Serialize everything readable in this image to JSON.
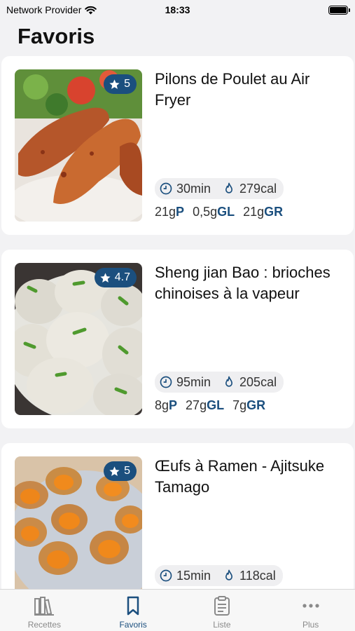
{
  "status": {
    "carrier": "Network Provider",
    "time": "18:33"
  },
  "page": {
    "title": "Favoris"
  },
  "recipes": [
    {
      "title": "Pilons de Poulet au Air Fryer",
      "rating": "5",
      "time": "30min",
      "calories": "279cal",
      "protein": "21g",
      "protein_unit": "P",
      "lipids": "0,5g",
      "lipids_unit": "GL",
      "carbs": "21g",
      "carbs_unit": "GR"
    },
    {
      "title": "Sheng jian Bao : brioches chinoises à la vapeur",
      "rating": "4.7",
      "time": "95min",
      "calories": "205cal",
      "protein": "8g",
      "protein_unit": "P",
      "lipids": "27g",
      "lipids_unit": "GL",
      "carbs": "7g",
      "carbs_unit": "GR"
    },
    {
      "title": "Œufs à Ramen - Ajitsuke Tamago",
      "rating": "5",
      "time": "15min",
      "calories": "118cal"
    }
  ],
  "tabs": [
    {
      "label": "Recettes",
      "icon": "books-icon"
    },
    {
      "label": "Favoris",
      "icon": "bookmark-icon"
    },
    {
      "label": "Liste",
      "icon": "clipboard-icon"
    },
    {
      "label": "Plus",
      "icon": "more-icon"
    }
  ],
  "colors": {
    "accent": "#1b4f7e",
    "background": "#f2f2f4"
  }
}
